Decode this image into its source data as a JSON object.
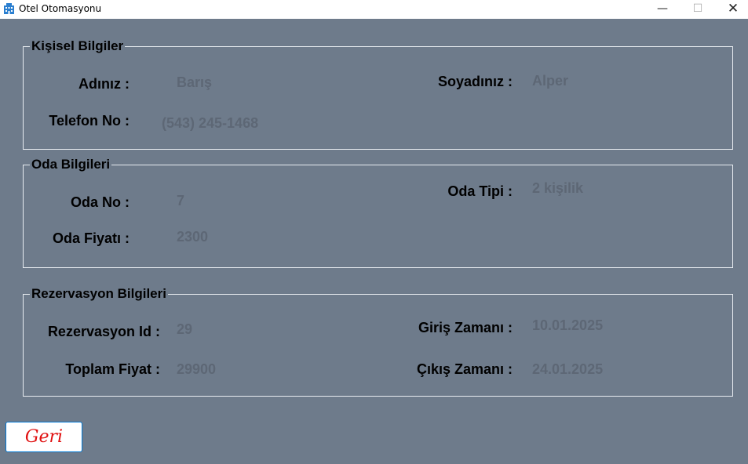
{
  "window": {
    "title": "Otel Otomasyonu",
    "minimize": "—",
    "maximize": "☐",
    "close": "✕"
  },
  "personal": {
    "title": "Kişisel Bilgiler",
    "name_label": "Adınız :",
    "name_value": "Barış",
    "surname_label": "Soyadınız :",
    "surname_value": "Alper",
    "phone_label": "Telefon No :",
    "phone_value": "(543) 245-1468"
  },
  "room": {
    "title": "Oda Bilgileri",
    "no_label": "Oda No :",
    "no_value": "7",
    "type_label": "Oda Tipi :",
    "type_value": "2 kişilik",
    "price_label": "Oda Fiyatı :",
    "price_value": "2300"
  },
  "reservation": {
    "title": "Rezervasyon Bilgileri",
    "id_label": "Rezervasyon Id :",
    "id_value": "29",
    "checkin_label": "Giriş Zamanı :",
    "checkin_value": "10.01.2025",
    "total_label": "Toplam Fiyat :",
    "total_value": "29900",
    "checkout_label": "Çıkış Zamanı :",
    "checkout_value": "24.01.2025"
  },
  "buttons": {
    "back": "Geri"
  },
  "colors": {
    "background": "#6e7b8b",
    "value_text": "#5d6775",
    "back_text": "#e01010",
    "back_border": "#0078d4"
  }
}
